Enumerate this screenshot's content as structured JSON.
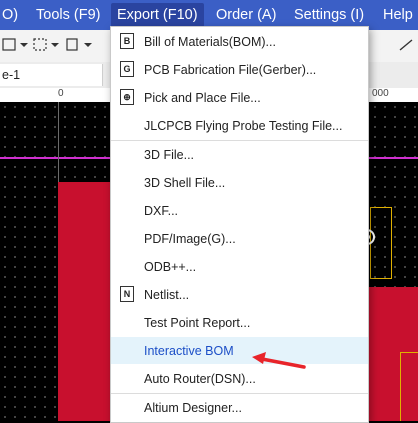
{
  "menubar": {
    "items": [
      "O)",
      "Tools (F9)",
      "Export (F10)",
      "Order (A)",
      "Settings (I)",
      "Help"
    ]
  },
  "tab": {
    "label": "e-1"
  },
  "ruler": {
    "labels": [
      "0",
      "000"
    ]
  },
  "export_menu": {
    "items": [
      {
        "label": "Bill of Materials(BOM)...",
        "icon": "bom-icon"
      },
      {
        "label": "PCB Fabrication File(Gerber)...",
        "icon": "gerber-icon"
      },
      {
        "label": "Pick and Place File...",
        "icon": "pick-place-icon"
      },
      {
        "label": "JLCPCB Flying Probe Testing File...",
        "icon": ""
      },
      {
        "label": "3D File...",
        "icon": ""
      },
      {
        "label": "3D Shell File...",
        "icon": ""
      },
      {
        "label": "DXF...",
        "icon": ""
      },
      {
        "label": "PDF/Image(G)...",
        "icon": ""
      },
      {
        "label": "ODB++...",
        "icon": ""
      },
      {
        "label": "Netlist...",
        "icon": "netlist-icon"
      },
      {
        "label": "Test Point Report...",
        "icon": ""
      },
      {
        "label": "Interactive BOM",
        "icon": ""
      },
      {
        "label": "Auto Router(DSN)...",
        "icon": ""
      },
      {
        "label": "Altium Designer...",
        "icon": ""
      }
    ],
    "highlighted_index": 11
  },
  "colors": {
    "menubar": "#3b5fc6",
    "highlight": "#e4f3fb",
    "arrow": "#e8242a"
  }
}
